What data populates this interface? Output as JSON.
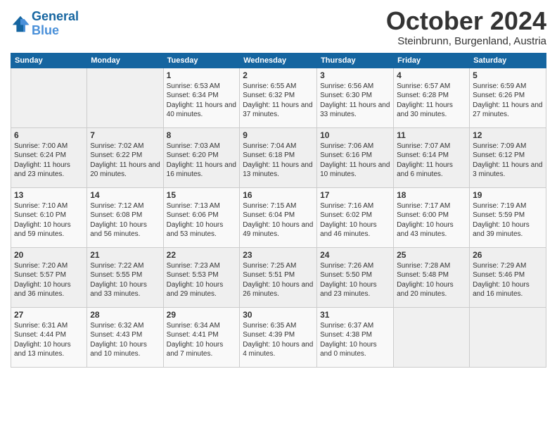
{
  "header": {
    "title": "October 2024",
    "location": "Steinbrunn, Burgenland, Austria"
  },
  "columns": [
    "Sunday",
    "Monday",
    "Tuesday",
    "Wednesday",
    "Thursday",
    "Friday",
    "Saturday"
  ],
  "weeks": [
    [
      {
        "day": "",
        "sunrise": "",
        "sunset": "",
        "daylight": ""
      },
      {
        "day": "",
        "sunrise": "",
        "sunset": "",
        "daylight": ""
      },
      {
        "day": "1",
        "sunrise": "Sunrise: 6:53 AM",
        "sunset": "Sunset: 6:34 PM",
        "daylight": "Daylight: 11 hours and 40 minutes."
      },
      {
        "day": "2",
        "sunrise": "Sunrise: 6:55 AM",
        "sunset": "Sunset: 6:32 PM",
        "daylight": "Daylight: 11 hours and 37 minutes."
      },
      {
        "day": "3",
        "sunrise": "Sunrise: 6:56 AM",
        "sunset": "Sunset: 6:30 PM",
        "daylight": "Daylight: 11 hours and 33 minutes."
      },
      {
        "day": "4",
        "sunrise": "Sunrise: 6:57 AM",
        "sunset": "Sunset: 6:28 PM",
        "daylight": "Daylight: 11 hours and 30 minutes."
      },
      {
        "day": "5",
        "sunrise": "Sunrise: 6:59 AM",
        "sunset": "Sunset: 6:26 PM",
        "daylight": "Daylight: 11 hours and 27 minutes."
      }
    ],
    [
      {
        "day": "6",
        "sunrise": "Sunrise: 7:00 AM",
        "sunset": "Sunset: 6:24 PM",
        "daylight": "Daylight: 11 hours and 23 minutes."
      },
      {
        "day": "7",
        "sunrise": "Sunrise: 7:02 AM",
        "sunset": "Sunset: 6:22 PM",
        "daylight": "Daylight: 11 hours and 20 minutes."
      },
      {
        "day": "8",
        "sunrise": "Sunrise: 7:03 AM",
        "sunset": "Sunset: 6:20 PM",
        "daylight": "Daylight: 11 hours and 16 minutes."
      },
      {
        "day": "9",
        "sunrise": "Sunrise: 7:04 AM",
        "sunset": "Sunset: 6:18 PM",
        "daylight": "Daylight: 11 hours and 13 minutes."
      },
      {
        "day": "10",
        "sunrise": "Sunrise: 7:06 AM",
        "sunset": "Sunset: 6:16 PM",
        "daylight": "Daylight: 11 hours and 10 minutes."
      },
      {
        "day": "11",
        "sunrise": "Sunrise: 7:07 AM",
        "sunset": "Sunset: 6:14 PM",
        "daylight": "Daylight: 11 hours and 6 minutes."
      },
      {
        "day": "12",
        "sunrise": "Sunrise: 7:09 AM",
        "sunset": "Sunset: 6:12 PM",
        "daylight": "Daylight: 11 hours and 3 minutes."
      }
    ],
    [
      {
        "day": "13",
        "sunrise": "Sunrise: 7:10 AM",
        "sunset": "Sunset: 6:10 PM",
        "daylight": "Daylight: 10 hours and 59 minutes."
      },
      {
        "day": "14",
        "sunrise": "Sunrise: 7:12 AM",
        "sunset": "Sunset: 6:08 PM",
        "daylight": "Daylight: 10 hours and 56 minutes."
      },
      {
        "day": "15",
        "sunrise": "Sunrise: 7:13 AM",
        "sunset": "Sunset: 6:06 PM",
        "daylight": "Daylight: 10 hours and 53 minutes."
      },
      {
        "day": "16",
        "sunrise": "Sunrise: 7:15 AM",
        "sunset": "Sunset: 6:04 PM",
        "daylight": "Daylight: 10 hours and 49 minutes."
      },
      {
        "day": "17",
        "sunrise": "Sunrise: 7:16 AM",
        "sunset": "Sunset: 6:02 PM",
        "daylight": "Daylight: 10 hours and 46 minutes."
      },
      {
        "day": "18",
        "sunrise": "Sunrise: 7:17 AM",
        "sunset": "Sunset: 6:00 PM",
        "daylight": "Daylight: 10 hours and 43 minutes."
      },
      {
        "day": "19",
        "sunrise": "Sunrise: 7:19 AM",
        "sunset": "Sunset: 5:59 PM",
        "daylight": "Daylight: 10 hours and 39 minutes."
      }
    ],
    [
      {
        "day": "20",
        "sunrise": "Sunrise: 7:20 AM",
        "sunset": "Sunset: 5:57 PM",
        "daylight": "Daylight: 10 hours and 36 minutes."
      },
      {
        "day": "21",
        "sunrise": "Sunrise: 7:22 AM",
        "sunset": "Sunset: 5:55 PM",
        "daylight": "Daylight: 10 hours and 33 minutes."
      },
      {
        "day": "22",
        "sunrise": "Sunrise: 7:23 AM",
        "sunset": "Sunset: 5:53 PM",
        "daylight": "Daylight: 10 hours and 29 minutes."
      },
      {
        "day": "23",
        "sunrise": "Sunrise: 7:25 AM",
        "sunset": "Sunset: 5:51 PM",
        "daylight": "Daylight: 10 hours and 26 minutes."
      },
      {
        "day": "24",
        "sunrise": "Sunrise: 7:26 AM",
        "sunset": "Sunset: 5:50 PM",
        "daylight": "Daylight: 10 hours and 23 minutes."
      },
      {
        "day": "25",
        "sunrise": "Sunrise: 7:28 AM",
        "sunset": "Sunset: 5:48 PM",
        "daylight": "Daylight: 10 hours and 20 minutes."
      },
      {
        "day": "26",
        "sunrise": "Sunrise: 7:29 AM",
        "sunset": "Sunset: 5:46 PM",
        "daylight": "Daylight: 10 hours and 16 minutes."
      }
    ],
    [
      {
        "day": "27",
        "sunrise": "Sunrise: 6:31 AM",
        "sunset": "Sunset: 4:44 PM",
        "daylight": "Daylight: 10 hours and 13 minutes."
      },
      {
        "day": "28",
        "sunrise": "Sunrise: 6:32 AM",
        "sunset": "Sunset: 4:43 PM",
        "daylight": "Daylight: 10 hours and 10 minutes."
      },
      {
        "day": "29",
        "sunrise": "Sunrise: 6:34 AM",
        "sunset": "Sunset: 4:41 PM",
        "daylight": "Daylight: 10 hours and 7 minutes."
      },
      {
        "day": "30",
        "sunrise": "Sunrise: 6:35 AM",
        "sunset": "Sunset: 4:39 PM",
        "daylight": "Daylight: 10 hours and 4 minutes."
      },
      {
        "day": "31",
        "sunrise": "Sunrise: 6:37 AM",
        "sunset": "Sunset: 4:38 PM",
        "daylight": "Daylight: 10 hours and 0 minutes."
      },
      {
        "day": "",
        "sunrise": "",
        "sunset": "",
        "daylight": ""
      },
      {
        "day": "",
        "sunrise": "",
        "sunset": "",
        "daylight": ""
      }
    ]
  ]
}
